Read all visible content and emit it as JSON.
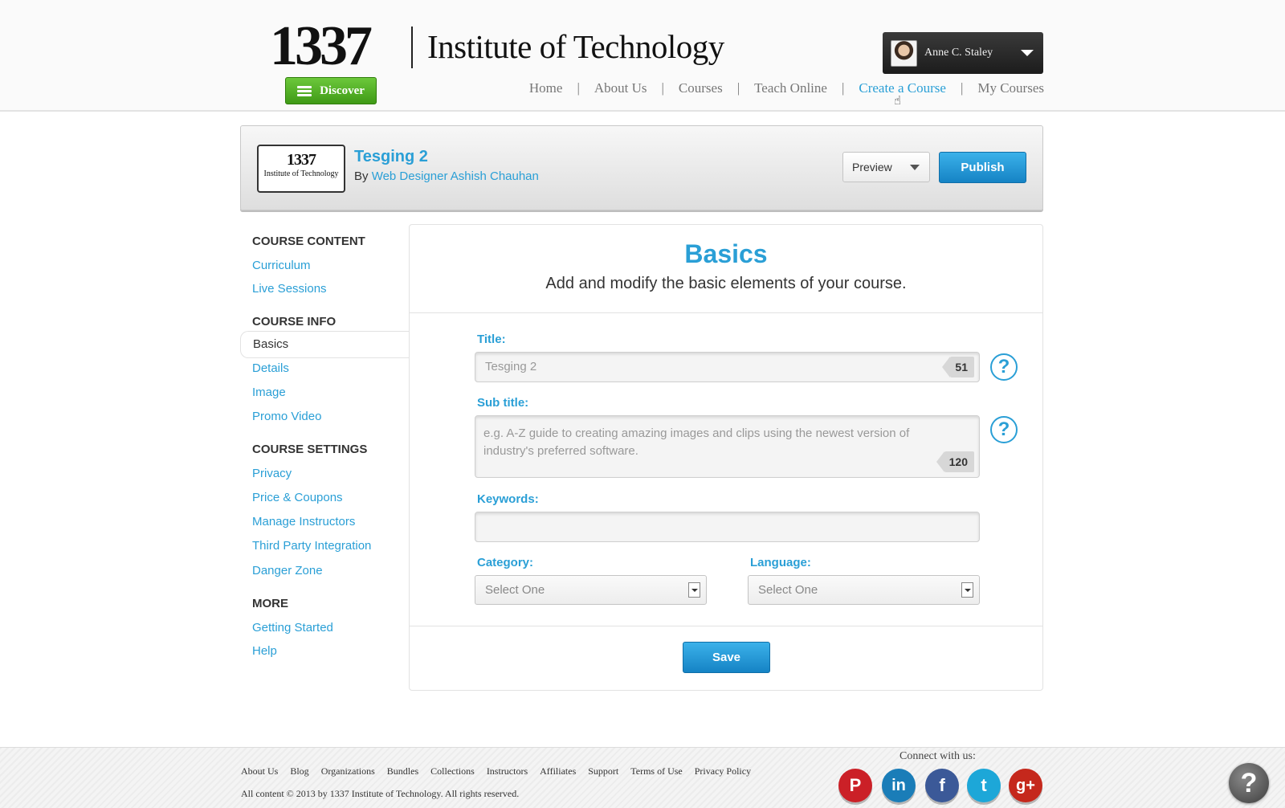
{
  "header": {
    "logo_number": "1337",
    "logo_name": "Institute of Technology",
    "discover_label": "Discover",
    "user_name": "Anne C. Staley",
    "nav": [
      {
        "label": "Home"
      },
      {
        "label": "About Us"
      },
      {
        "label": "Courses"
      },
      {
        "label": "Teach Online"
      },
      {
        "label": "Create a Course"
      },
      {
        "label": "My Courses"
      }
    ],
    "active_nav": "Create a Course"
  },
  "course": {
    "thumb_number": "1337",
    "thumb_name": "Institute of Technology",
    "title": "Tesging 2",
    "by_prefix": "By",
    "author": "Web Designer Ashish Chauhan",
    "preview_label": "Preview",
    "publish_label": "Publish"
  },
  "sidebar": {
    "sections": [
      {
        "heading": "COURSE CONTENT",
        "items": [
          "Curriculum",
          "Live Sessions"
        ]
      },
      {
        "heading": "COURSE INFO",
        "items": [
          "Basics",
          "Details",
          "Image",
          "Promo Video"
        ]
      },
      {
        "heading": "COURSE SETTINGS",
        "items": [
          "Privacy",
          "Price & Coupons",
          "Manage Instructors",
          "Third Party Integration",
          "Danger Zone"
        ]
      },
      {
        "heading": "MORE",
        "items": [
          "Getting Started",
          "Help"
        ]
      }
    ],
    "active_item": "Basics"
  },
  "main": {
    "title": "Basics",
    "subtitle": "Add and modify the basic elements of your course.",
    "title_field": {
      "label": "Title:",
      "value": "Tesging 2",
      "counter": "51"
    },
    "subtitle_field": {
      "label": "Sub title:",
      "placeholder": "e.g. A-Z guide to creating amazing images and clips using the newest version of industry's preferred software.",
      "counter": "120"
    },
    "keywords_field": {
      "label": "Keywords:",
      "value": ""
    },
    "category_field": {
      "label": "Category:",
      "selected": "Select One"
    },
    "language_field": {
      "label": "Language:",
      "selected": "Select One"
    },
    "help_glyph": "?",
    "save_label": "Save"
  },
  "footer": {
    "links": [
      "About Us",
      "Blog",
      "Organizations",
      "Bundles",
      "Collections",
      "Instructors",
      "Affiliates",
      "Support",
      "Terms of Use",
      "Privacy Policy"
    ],
    "copyright": "All content © 2013 by 1337 Institute of Technology. All rights reserved.",
    "connect_label": "Connect with us:",
    "social": [
      {
        "name": "pinterest",
        "glyph": "P",
        "color": "#cb2027"
      },
      {
        "name": "linkedin",
        "glyph": "in",
        "color": "#1a7db8"
      },
      {
        "name": "facebook",
        "glyph": "f",
        "color": "#3b5998"
      },
      {
        "name": "twitter",
        "glyph": "t",
        "color": "#1da7d8"
      },
      {
        "name": "google-plus",
        "glyph": "g+",
        "color": "#c5281c"
      }
    ],
    "help_glyph": "?"
  },
  "colors": {
    "accent": "#2a9fd6",
    "discover_green": "#4fae22",
    "publish_blue": "#1a8fd0"
  }
}
